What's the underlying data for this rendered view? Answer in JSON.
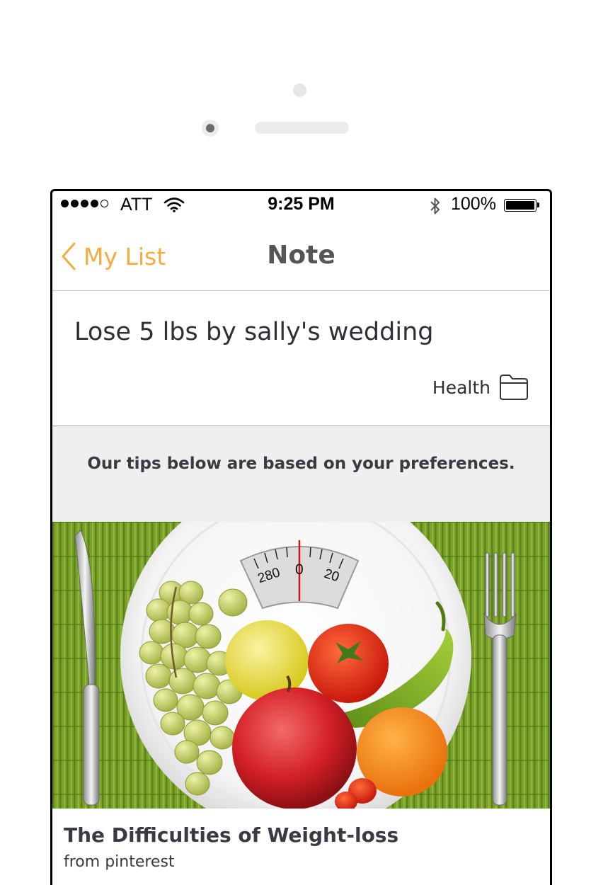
{
  "status_bar": {
    "carrier": "ATT",
    "time": "9:25 PM",
    "battery": "100%",
    "signal_bars": 4,
    "signal_total": 5
  },
  "nav": {
    "back_label": "My List",
    "title": "Note"
  },
  "note": {
    "title": "Lose 5 lbs by sally's wedding",
    "category": "Health"
  },
  "tips": {
    "message": "Our tips below are based on your preferences."
  },
  "article": {
    "title": "The Difficulties of Weight-loss",
    "source": "from pinterest",
    "scale_labels": [
      "280",
      "0",
      "20"
    ]
  },
  "colors": {
    "accent": "#f2ad3e",
    "text_dark": "#2f2f38",
    "banner_bg": "#efefef"
  },
  "icons": [
    "wifi-icon",
    "bluetooth-icon",
    "battery-icon",
    "chevron-left-icon",
    "folder-icon"
  ]
}
